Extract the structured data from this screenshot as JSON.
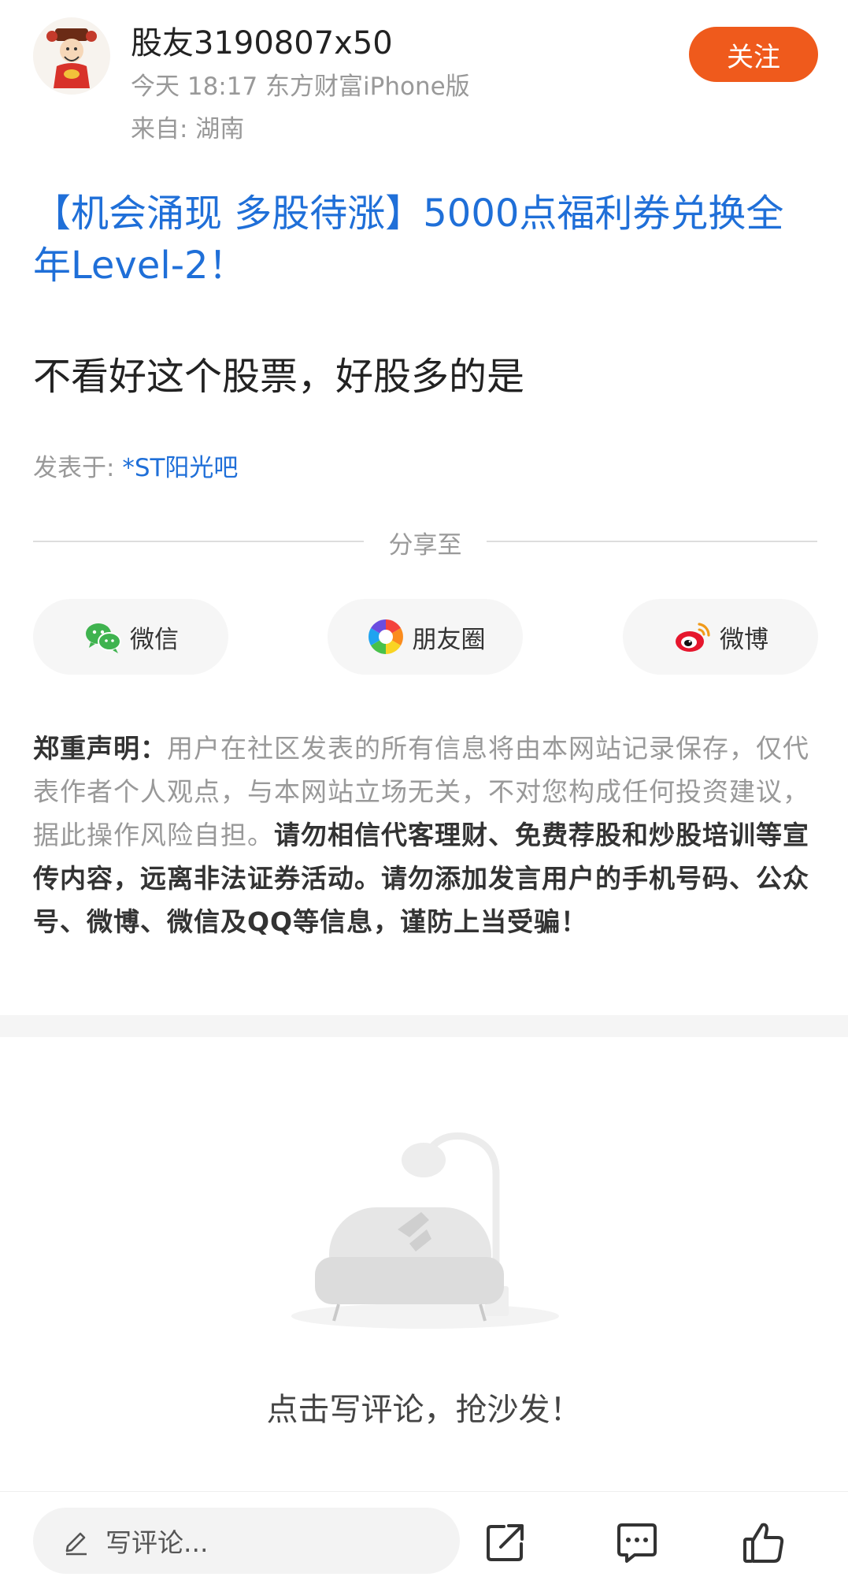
{
  "post": {
    "author": "股友3190807x50",
    "time_source": "今天 18:17 东方财富iPhone版",
    "location": "来自: 湖南",
    "follow_label": "关注",
    "title": "【机会涌现 多股待涨】5000点福利券兑换全年Level-2！",
    "body": "不看好这个股票，好股多的是",
    "posted_in_prefix": "发表于: ",
    "posted_in_bar": "*ST阳光吧"
  },
  "share": {
    "label": "分享至",
    "wechat": "微信",
    "moments": "朋友圈",
    "weibo": "微博"
  },
  "disclaimer": {
    "heading": "郑重声明：",
    "part1": "用户在社区发表的所有信息将由本网站记录保存，仅代表作者个人观点，与本网站立场无关，不对您构成任何投资建议，据此操作风险自担。",
    "part2": "请勿相信代客理财、免费荐股和炒股培训等宣传内容，远离非法证券活动。请勿添加发言用户的手机号码、公众号、微博、微信及QQ等信息，谨防上当受骗！"
  },
  "comments": {
    "empty_text": "点击写评论，抢沙发！"
  },
  "bottom_bar": {
    "input_placeholder": "写评论..."
  },
  "icons": {
    "avatar": "caishen-avatar",
    "wechat": "wechat-icon",
    "moments": "moments-icon",
    "weibo": "weibo-icon",
    "pen": "pen-icon",
    "share": "share-out-icon",
    "comment": "comment-icon",
    "like": "thumbs-up-icon"
  },
  "colors": {
    "accent_orange": "#ef5a1c",
    "link_blue": "#1f6fd8"
  }
}
